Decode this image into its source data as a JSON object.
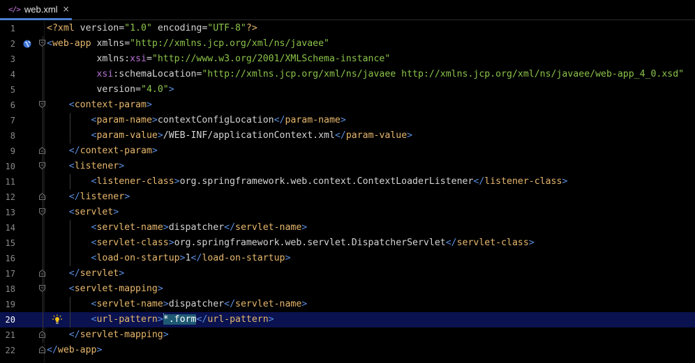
{
  "tab": {
    "icon": "xml-code-icon",
    "name": "web.xml",
    "close": "×"
  },
  "current_line": 20,
  "lines": [
    {
      "n": "1",
      "tokens": [
        [
          "t-pi",
          "<?xml "
        ],
        [
          "t-attr",
          "version"
        ],
        [
          "t-eq",
          "="
        ],
        [
          "t-val",
          "\"1.0\""
        ],
        [
          "t-attr",
          " encoding"
        ],
        [
          "t-eq",
          "="
        ],
        [
          "t-val",
          "\"UTF-8\""
        ],
        [
          "t-pi",
          "?>"
        ]
      ]
    },
    {
      "n": "2",
      "tokens": [
        [
          "t-br",
          "<"
        ],
        [
          "t-tag",
          "web-app "
        ],
        [
          "t-attr",
          "xmlns"
        ],
        [
          "t-eq",
          "="
        ],
        [
          "t-val",
          "\"http://xmlns.jcp.org/xml/ns/javaee\""
        ]
      ]
    },
    {
      "n": "3",
      "tokens": [
        [
          "t-text",
          "         "
        ],
        [
          "t-attr",
          "xmlns"
        ],
        [
          "t-eq",
          ":"
        ],
        [
          "t-ns",
          "xsi"
        ],
        [
          "t-eq",
          "="
        ],
        [
          "t-val",
          "\"http://www.w3.org/2001/XMLSchema-instance\""
        ]
      ]
    },
    {
      "n": "4",
      "tokens": [
        [
          "t-text",
          "         "
        ],
        [
          "t-ns",
          "xsi"
        ],
        [
          "t-eq",
          ":"
        ],
        [
          "t-attr",
          "schemaLocation"
        ],
        [
          "t-eq",
          "="
        ],
        [
          "t-val",
          "\"http://xmlns.jcp.org/xml/ns/javaee http://xmlns.jcp.org/xml/ns/javaee/web-app_4_0.xsd\""
        ]
      ]
    },
    {
      "n": "5",
      "tokens": [
        [
          "t-text",
          "         "
        ],
        [
          "t-attr",
          "version"
        ],
        [
          "t-eq",
          "="
        ],
        [
          "t-val",
          "\"4.0\""
        ],
        [
          "t-br",
          ">"
        ]
      ]
    },
    {
      "n": "6",
      "tokens": [
        [
          "t-text",
          "    "
        ],
        [
          "t-br",
          "<"
        ],
        [
          "t-tag",
          "context-param"
        ],
        [
          "t-br",
          ">"
        ]
      ]
    },
    {
      "n": "7",
      "tokens": [
        [
          "t-text",
          "        "
        ],
        [
          "t-br",
          "<"
        ],
        [
          "t-tag",
          "param-name"
        ],
        [
          "t-br",
          ">"
        ],
        [
          "t-text",
          "contextConfigLocation"
        ],
        [
          "t-br",
          "</"
        ],
        [
          "t-tag",
          "param-name"
        ],
        [
          "t-br",
          ">"
        ]
      ]
    },
    {
      "n": "8",
      "tokens": [
        [
          "t-text",
          "        "
        ],
        [
          "t-br",
          "<"
        ],
        [
          "t-tag",
          "param-value"
        ],
        [
          "t-br",
          ">"
        ],
        [
          "t-text",
          "/WEB-INF/applicationContext.xml"
        ],
        [
          "t-br",
          "</"
        ],
        [
          "t-tag",
          "param-value"
        ],
        [
          "t-br",
          ">"
        ]
      ]
    },
    {
      "n": "9",
      "tokens": [
        [
          "t-text",
          "    "
        ],
        [
          "t-br",
          "</"
        ],
        [
          "t-tag",
          "context-param"
        ],
        [
          "t-br",
          ">"
        ]
      ]
    },
    {
      "n": "10",
      "tokens": [
        [
          "t-text",
          "    "
        ],
        [
          "t-br",
          "<"
        ],
        [
          "t-tag",
          "listener"
        ],
        [
          "t-br",
          ">"
        ]
      ]
    },
    {
      "n": "11",
      "tokens": [
        [
          "t-text",
          "        "
        ],
        [
          "t-br",
          "<"
        ],
        [
          "t-tag",
          "listener-class"
        ],
        [
          "t-br",
          ">"
        ],
        [
          "t-text",
          "org.springframework.web.context.ContextLoaderListener"
        ],
        [
          "t-br",
          "</"
        ],
        [
          "t-tag",
          "listener-class"
        ],
        [
          "t-br",
          ">"
        ]
      ]
    },
    {
      "n": "12",
      "tokens": [
        [
          "t-text",
          "    "
        ],
        [
          "t-br",
          "</"
        ],
        [
          "t-tag",
          "listener"
        ],
        [
          "t-br",
          ">"
        ]
      ]
    },
    {
      "n": "13",
      "tokens": [
        [
          "t-text",
          "    "
        ],
        [
          "t-br",
          "<"
        ],
        [
          "t-tag",
          "servlet"
        ],
        [
          "t-br",
          ">"
        ]
      ]
    },
    {
      "n": "14",
      "tokens": [
        [
          "t-text",
          "        "
        ],
        [
          "t-br",
          "<"
        ],
        [
          "t-tag",
          "servlet-name"
        ],
        [
          "t-br",
          ">"
        ],
        [
          "t-text",
          "dispatcher"
        ],
        [
          "t-br",
          "</"
        ],
        [
          "t-tag",
          "servlet-name"
        ],
        [
          "t-br",
          ">"
        ]
      ]
    },
    {
      "n": "15",
      "tokens": [
        [
          "t-text",
          "        "
        ],
        [
          "t-br",
          "<"
        ],
        [
          "t-tag",
          "servlet-class"
        ],
        [
          "t-br",
          ">"
        ],
        [
          "t-text",
          "org.springframework.web.servlet.DispatcherServlet"
        ],
        [
          "t-br",
          "</"
        ],
        [
          "t-tag",
          "servlet-class"
        ],
        [
          "t-br",
          ">"
        ]
      ]
    },
    {
      "n": "16",
      "tokens": [
        [
          "t-text",
          "        "
        ],
        [
          "t-br",
          "<"
        ],
        [
          "t-tag",
          "load-on-startup"
        ],
        [
          "t-br",
          ">"
        ],
        [
          "t-text",
          "1"
        ],
        [
          "t-br",
          "</"
        ],
        [
          "t-tag",
          "load-on-startup"
        ],
        [
          "t-br",
          ">"
        ]
      ]
    },
    {
      "n": "17",
      "tokens": [
        [
          "t-text",
          "    "
        ],
        [
          "t-br",
          "</"
        ],
        [
          "t-tag",
          "servlet"
        ],
        [
          "t-br",
          ">"
        ]
      ]
    },
    {
      "n": "18",
      "tokens": [
        [
          "t-text",
          "    "
        ],
        [
          "t-br",
          "<"
        ],
        [
          "t-tag",
          "servlet-mapping"
        ],
        [
          "t-br",
          ">"
        ]
      ]
    },
    {
      "n": "19",
      "tokens": [
        [
          "t-text",
          "        "
        ],
        [
          "t-br",
          "<"
        ],
        [
          "t-tag",
          "servlet-name"
        ],
        [
          "t-br",
          ">"
        ],
        [
          "t-text",
          "dispatcher"
        ],
        [
          "t-br",
          "</"
        ],
        [
          "t-tag",
          "servlet-name"
        ],
        [
          "t-br",
          ">"
        ]
      ]
    },
    {
      "n": "20",
      "tokens": [
        [
          "t-text",
          "        "
        ],
        [
          "t-br",
          "<"
        ],
        [
          "t-tag",
          "url-pattern"
        ],
        [
          "t-br",
          ">"
        ],
        [
          "caret",
          ""
        ],
        [
          "sel",
          "*.form"
        ],
        [
          "t-br",
          "</"
        ],
        [
          "t-tag",
          "url-pattern"
        ],
        [
          "t-br",
          ">"
        ]
      ]
    },
    {
      "n": "21",
      "tokens": [
        [
          "t-text",
          "    "
        ],
        [
          "t-br",
          "</"
        ],
        [
          "t-tag",
          "servlet-mapping"
        ],
        [
          "t-br",
          ">"
        ]
      ]
    },
    {
      "n": "22",
      "tokens": [
        [
          "t-br",
          "</"
        ],
        [
          "t-tag",
          "web-app"
        ],
        [
          "t-br",
          ">"
        ]
      ]
    }
  ],
  "fold_open": [
    "2",
    "6",
    "10",
    "13",
    "18"
  ],
  "fold_close": [
    "9",
    "12",
    "17",
    "21",
    "22"
  ],
  "gutter_icons": {
    "2": "globe-icon",
    "20": "lightbulb-icon"
  }
}
